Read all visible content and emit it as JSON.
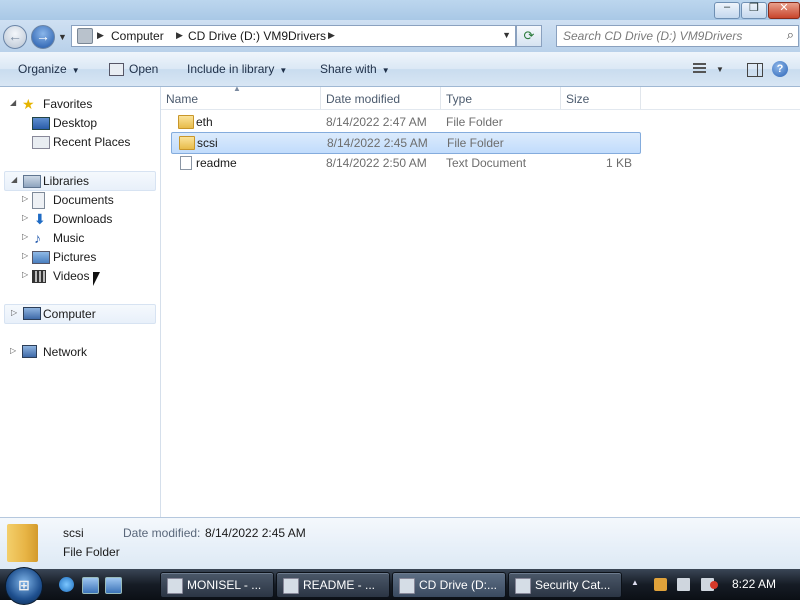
{
  "window": {
    "caption_buttons": {
      "minimize": "–",
      "maximize": "❐",
      "close": "✕"
    }
  },
  "nav": {
    "back_glyph": "←",
    "forward_glyph": "→",
    "breadcrumb": [
      "Computer",
      "CD Drive (D:) VM9Drivers"
    ],
    "search_placeholder": "Search CD Drive (D:) VM9Drivers"
  },
  "toolbar": {
    "organize": "Organize",
    "open": "Open",
    "include_in_library": "Include in library",
    "share_with": "Share with"
  },
  "navpane": {
    "favorites": {
      "label": "Favorites",
      "items": [
        "Desktop",
        "Recent Places"
      ]
    },
    "libraries": {
      "label": "Libraries",
      "items": [
        "Documents",
        "Downloads",
        "Music",
        "Pictures",
        "Videos"
      ]
    },
    "computer": "Computer",
    "network": "Network"
  },
  "filelist": {
    "columns": [
      "Name",
      "Date modified",
      "Type",
      "Size"
    ],
    "rows": [
      {
        "name": "eth",
        "date": "8/14/2022 2:47 AM",
        "type": "File Folder",
        "size": "",
        "icon": "folder-icon",
        "selected": false
      },
      {
        "name": "scsi",
        "date": "8/14/2022 2:45 AM",
        "type": "File Folder",
        "size": "",
        "icon": "folder-icon",
        "selected": true
      },
      {
        "name": "readme",
        "date": "8/14/2022 2:50 AM",
        "type": "Text Document",
        "size": "1 KB",
        "icon": "text-document-icon",
        "selected": false
      }
    ]
  },
  "details": {
    "name": "scsi",
    "type": "File Folder",
    "date_modified_label": "Date modified:",
    "date_modified_value": "8/14/2022 2:45 AM"
  },
  "taskbar": {
    "tasks": [
      {
        "label": "MONISEL - ...",
        "active": false
      },
      {
        "label": "README - ...",
        "active": false
      },
      {
        "label": "CD Drive (D:...",
        "active": true
      },
      {
        "label": "Security Cat...",
        "active": false
      }
    ],
    "clock": "8:22 AM"
  },
  "colors": {
    "selection_fill": "#c1dcfc",
    "selection_border": "#84acdd",
    "taskbar": "#161c25",
    "folder": "#e7bb4a"
  }
}
